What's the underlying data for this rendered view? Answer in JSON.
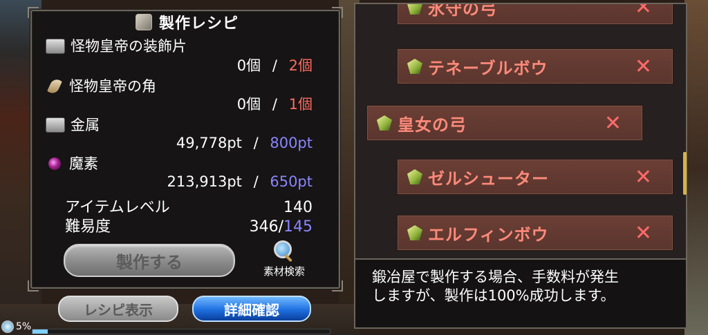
{
  "recipe_panel": {
    "title": "製作レシピ",
    "materials": [
      {
        "name": "怪物皇帝の装飾片",
        "icon": "metal-box-icon",
        "have": "0個",
        "separator": "/",
        "need": "2個"
      },
      {
        "name": "怪物皇帝の角",
        "icon": "horn-icon",
        "have": "0個",
        "separator": "/",
        "need": "1個"
      },
      {
        "name": "金属",
        "icon": "metal-box-icon",
        "have": "49,778pt",
        "separator": "/",
        "need": "800pt"
      },
      {
        "name": "魔素",
        "icon": "magic-orb-icon",
        "have": "213,913pt",
        "separator": "/",
        "need": "650pt"
      }
    ],
    "item_level_label": "アイテムレベル",
    "item_level_value": "140",
    "difficulty_label": "難易度",
    "difficulty_have": "346/",
    "difficulty_need": "145",
    "craft_button": "製作する",
    "search_label": "素材検索"
  },
  "bottom_bar": {
    "recipe_button": "レシピ表示",
    "detail_button": "詳細確認",
    "status_percent": "5%",
    "progress": 0.05
  },
  "recipe_list": {
    "items": [
      {
        "name": "氷守の弓",
        "remove": "✕"
      },
      {
        "name": "テネーブルボウ",
        "remove": "✕"
      },
      {
        "name": "皇女の弓",
        "remove": "✕"
      },
      {
        "name": "ゼルシューター",
        "remove": "✕"
      },
      {
        "name": "エルフィンボウ",
        "remove": "✕"
      }
    ]
  },
  "description": {
    "line1": "鍛冶屋で製作する場合、手数料が発生",
    "line2": "しますが、製作は100%成功します。"
  },
  "colors": {
    "need_red": "#ff6b5e",
    "need_blue": "#8a86ff",
    "item_name": "#ff8a7a",
    "detail_button": "#1e6fe0"
  }
}
